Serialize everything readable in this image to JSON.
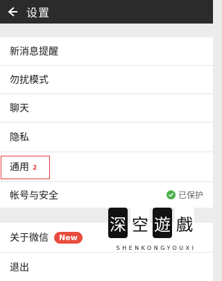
{
  "header": {
    "title": "设置"
  },
  "settings": {
    "group1": [
      "新消息提醒",
      "勿扰模式",
      "聊天",
      "隐私",
      "通用",
      "帐号与安全"
    ],
    "account_status": "已保护",
    "about": "关于微信",
    "new_badge": "New",
    "logout": "退出"
  },
  "annotation": {
    "marker": "2"
  },
  "watermark": {
    "chars": [
      "深",
      "空",
      "遊",
      "戲"
    ],
    "text": "SHENKONGYOUXI"
  },
  "colors": {
    "topbar": "#2b2b2b",
    "highlight": "#e33b3b",
    "badge": "#e84c3d",
    "shield": "#4cae4c"
  }
}
